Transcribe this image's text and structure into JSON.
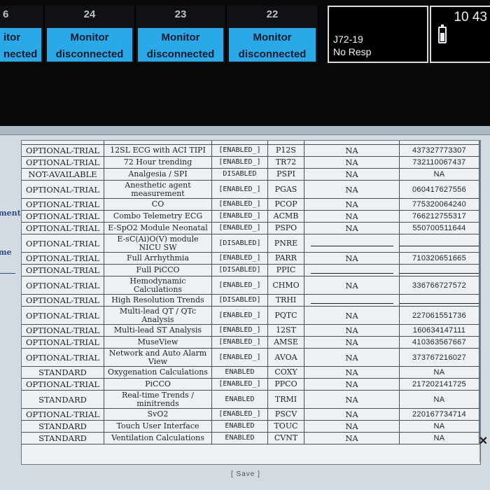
{
  "beds": [
    {
      "number": "6",
      "line1": "itor",
      "line2": "nected"
    },
    {
      "number": "24",
      "line1": "Monitor",
      "line2": "disconnected"
    },
    {
      "number": "23",
      "line1": "Monitor",
      "line2": "disconnected"
    },
    {
      "number": "22",
      "line1": "Monitor",
      "line2": "disconnected"
    }
  ],
  "alarm": {
    "line1": "J72-19",
    "line2": "No Resp"
  },
  "clock": {
    "time": "10 43"
  },
  "side_labels": {
    "item1": "ment",
    "item2": "me"
  },
  "options": {
    "rows": [
      {
        "status": "OPTIONAL-TRIAL",
        "name": "12SL ECG with ACI TIPI",
        "state": "[ENABLED_]",
        "code": "P12S",
        "na": "NA",
        "key": "437327773307"
      },
      {
        "status": "OPTIONAL-TRIAL",
        "name": "72 Hour trending",
        "state": "[ENABLED_]",
        "code": "TR72",
        "na": "NA",
        "key": "732110067437"
      },
      {
        "status": "NOT-AVAILABLE",
        "name": "Analgesia / SPI",
        "state": "DISABLED",
        "code": "PSPI",
        "na": "NA",
        "key": "NA"
      },
      {
        "status": "OPTIONAL-TRIAL",
        "name": "Anesthetic agent measurement",
        "state": "[ENABLED_]",
        "code": "PGAS",
        "na": "NA",
        "key": "060417627556"
      },
      {
        "status": "OPTIONAL-TRIAL",
        "name": "CO",
        "state": "[ENABLED_]",
        "code": "PCOP",
        "na": "NA",
        "key": "775320064240"
      },
      {
        "status": "OPTIONAL-TRIAL",
        "name": "Combo Telemetry ECG",
        "state": "[ENABLED_]",
        "code": "ACMB",
        "na": "NA",
        "key": "766212755317"
      },
      {
        "status": "OPTIONAL-TRIAL",
        "name": "E-SpO2 Module Neonatal",
        "state": "[ENABLED_]",
        "code": "PSPO",
        "na": "NA",
        "key": "550700511644"
      },
      {
        "status": "OPTIONAL-TRIAL",
        "name": "E-sC(Ai)O(V) module NICU SW",
        "state": "[DISABLED]",
        "code": "PNRE",
        "na": "",
        "key": ""
      },
      {
        "status": "OPTIONAL-TRIAL",
        "name": "Full Arrhythmia",
        "state": "[ENABLED_]",
        "code": "PARR",
        "na": "NA",
        "key": "710320651665"
      },
      {
        "status": "OPTIONAL-TRIAL",
        "name": "Full PiCCO",
        "state": "[DISABLED]",
        "code": "PPIC",
        "na": "",
        "key": ""
      },
      {
        "status": "OPTIONAL-TRIAL",
        "name": "Hemodynamic Calculations",
        "state": "[ENABLED_]",
        "code": "CHMO",
        "na": "NA",
        "key": "336766727572"
      },
      {
        "status": "OPTIONAL-TRIAL",
        "name": "High Resolution Trends",
        "state": "[DISABLED]",
        "code": "TRHI",
        "na": "",
        "key": ""
      },
      {
        "status": "OPTIONAL-TRIAL",
        "name": "Multi-lead QT / QTc Analysis",
        "state": "[ENABLED_]",
        "code": "PQTC",
        "na": "NA",
        "key": "227061551736"
      },
      {
        "status": "OPTIONAL-TRIAL",
        "name": "Multi-lead ST Analysis",
        "state": "[ENABLED_]",
        "code": "12ST",
        "na": "NA",
        "key": "160634147111"
      },
      {
        "status": "OPTIONAL-TRIAL",
        "name": "MuseView",
        "state": "[ENABLED_]",
        "code": "AMSE",
        "na": "NA",
        "key": "410363567667"
      },
      {
        "status": "OPTIONAL-TRIAL",
        "name": "Network and Auto Alarm View",
        "state": "[ENABLED_]",
        "code": "AVOA",
        "na": "NA",
        "key": "373767216027"
      },
      {
        "status": "STANDARD",
        "name": "Oxygenation Calculations",
        "state": "ENABLED",
        "code": "COXY",
        "na": "NA",
        "key": "NA"
      },
      {
        "status": "OPTIONAL-TRIAL",
        "name": "PiCCO",
        "state": "[ENABLED_]",
        "code": "PPCO",
        "na": "NA",
        "key": "217202141725"
      },
      {
        "status": "STANDARD",
        "name": "Real-time Trends / minitrends",
        "state": "ENABLED",
        "code": "TRMI",
        "na": "NA",
        "key": "NA"
      },
      {
        "status": "OPTIONAL-TRIAL",
        "name": "SvO2",
        "state": "[ENABLED_]",
        "code": "PSCV",
        "na": "NA",
        "key": "220167734714"
      },
      {
        "status": "STANDARD",
        "name": "Touch User Interface",
        "state": "ENABLED",
        "code": "TOUC",
        "na": "NA",
        "key": "NA"
      },
      {
        "status": "STANDARD",
        "name": "Ventilation Calculations",
        "state": "ENABLED",
        "code": "CVNT",
        "na": "NA",
        "key": "NA"
      }
    ]
  },
  "save_label": "[ Save ]",
  "colors": {
    "bed_panel": "#2aa9e8",
    "window_bg": "#d3dae0",
    "accent_text": "#2a4d93"
  }
}
